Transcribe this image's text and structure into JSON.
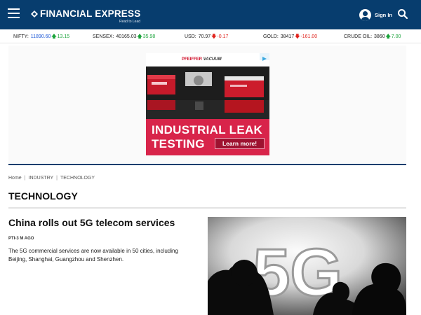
{
  "header": {
    "brand": "FINANCIAL EXPRESS",
    "tagline": "Read to Lead",
    "sign_in_label": "Sign In",
    "icons": {
      "menu": "hamburger-menu-icon",
      "user": "user-icon",
      "search": "search-icon"
    },
    "colors": {
      "header_bg": "#073d6e"
    }
  },
  "ticker": [
    {
      "name": "NIFTY:",
      "value": "11890.60",
      "direction": "up",
      "change": "13.15"
    },
    {
      "name": "SENSEX:",
      "value": "40165.03",
      "direction": "up",
      "change": "35.98"
    },
    {
      "name": "USD:",
      "value": "70.97",
      "direction": "down",
      "change": "-0.17"
    },
    {
      "name": "GOLD:",
      "value": "38417",
      "direction": "down",
      "change": "-161.00"
    },
    {
      "name": "CRUDE OIL:",
      "value": "3860",
      "direction": "up",
      "change": "7.00"
    }
  ],
  "ad": {
    "brand_part1": "PFEIFFER",
    "brand_part2": "VACUUM",
    "headline_line1": "INDUSTRIAL LEAK",
    "headline_line2": "TESTING",
    "cta": "Learn more!",
    "colors": {
      "accent": "#d8244a"
    }
  },
  "breadcrumb": [
    "Home",
    "INDUSTRY",
    "TECHNOLOGY"
  ],
  "breadcrumb_separator": "|",
  "section_title": "TECHNOLOGY",
  "article": {
    "headline": "China rolls out 5G telecom services",
    "byline": "PTI-3 M AGO",
    "summary": "The 5G commercial services are now available in 50 cities, including Beijing, Shanghai, Guangzhou and Shenzhen.",
    "image_text": "5G"
  },
  "colors": {
    "up": "#1aa33a",
    "down": "#e0231c",
    "value_highlight": "#1a56d6"
  }
}
